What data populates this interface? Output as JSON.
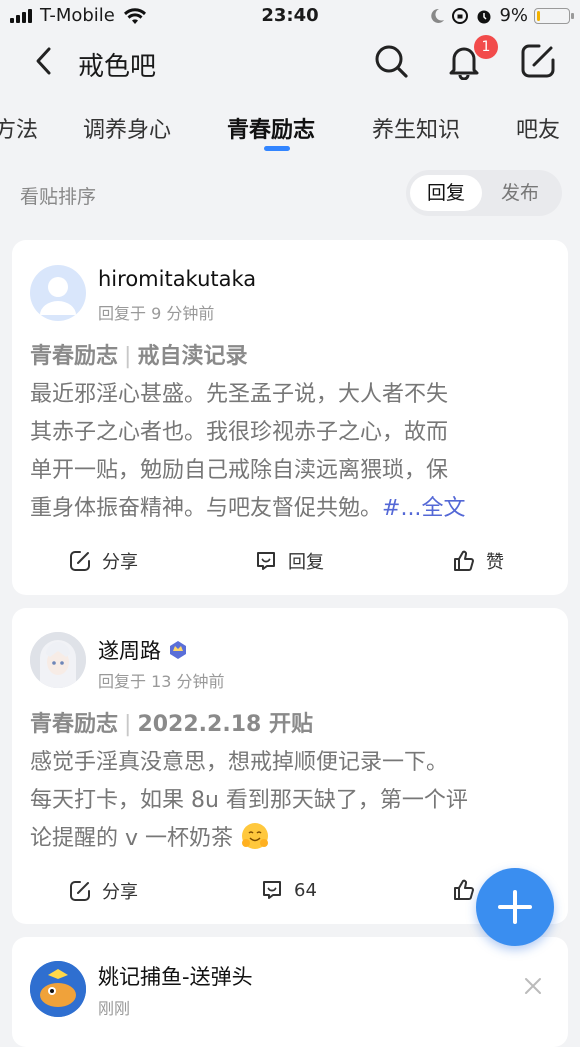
{
  "status": {
    "carrier": "T-Mobile",
    "time": "23:40",
    "battery_text": "9%",
    "battery_level": 0.09
  },
  "nav": {
    "title": "戒色吧",
    "notification_count": "1"
  },
  "tabs": [
    {
      "label": "方法"
    },
    {
      "label": "调养身心"
    },
    {
      "label": "青春励志",
      "active": true
    },
    {
      "label": "养生知识"
    },
    {
      "label": "吧友"
    }
  ],
  "sort": {
    "label": "看贴排序",
    "options": [
      "回复",
      "发布"
    ],
    "selected": "回复"
  },
  "posts": [
    {
      "username": "hiromitakutaka",
      "time": "回复于 9 分钟前",
      "category": "青春励志",
      "title": "戒自渎记录",
      "lines": [
        "最近邪淫心甚盛。先圣孟子说，大人者不失",
        "其赤子之心者也。我很珍视赤子之心，故而",
        "单开一贴，勉励自己戒除自渎远离猥琐，保",
        "重身体振奋精神。与吧友督促共勉。"
      ],
      "more_prefix": "#...",
      "more_label": "全文",
      "actions": {
        "share": "分享",
        "reply": "回复",
        "like": "赞"
      }
    },
    {
      "username": "遂周路",
      "time": "回复于 13 分钟前",
      "category": "青春励志",
      "title": "2022.2.18 开贴",
      "lines": [
        "感觉手淫真没意思，想戒掉顺便记录一下。",
        "每天打卡，如果 8u 看到那天缺了，第一个评",
        "论提醒的 v 一杯奶茶"
      ],
      "actions": {
        "share": "分享",
        "reply": "64"
      }
    },
    {
      "username": "姚记捕鱼-送弹头",
      "time": "刚刚"
    }
  ],
  "colors": {
    "accent": "#3385ff",
    "fab": "#3a8ef0",
    "badge": "#f24b4b",
    "link": "#5468d6"
  }
}
